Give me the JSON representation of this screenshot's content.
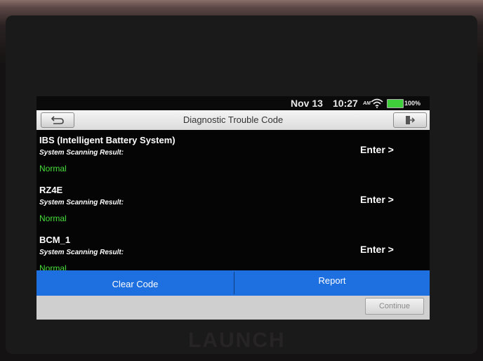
{
  "status_bar": {
    "date": "Nov 13",
    "time": "10:27",
    "ampm": "AM",
    "battery": "100%",
    "icons": [
      "wifi-icon",
      "battery-icon"
    ]
  },
  "header": {
    "title": "Diagnostic Trouble Code",
    "back_icon": "back-arrow-icon",
    "exit_icon": "exit-icon"
  },
  "systems": [
    {
      "name": "IBS (Intelligent Battery System)",
      "label": "System Scanning Result:",
      "status": "Normal",
      "action": "Enter >"
    },
    {
      "name": "RZ4E",
      "label": "System Scanning Result:",
      "status": "Normal",
      "action": "Enter >"
    },
    {
      "name": "BCM_1",
      "label": "System Scanning Result:",
      "status": "Normal",
      "action": "Enter >"
    }
  ],
  "actions": {
    "clear_code": "Clear Code",
    "report": "Report",
    "continue": "Continue"
  },
  "brand": "LAUNCH",
  "colors": {
    "status_normal": "#48e03c",
    "action_bar": "#1e6fe0"
  }
}
